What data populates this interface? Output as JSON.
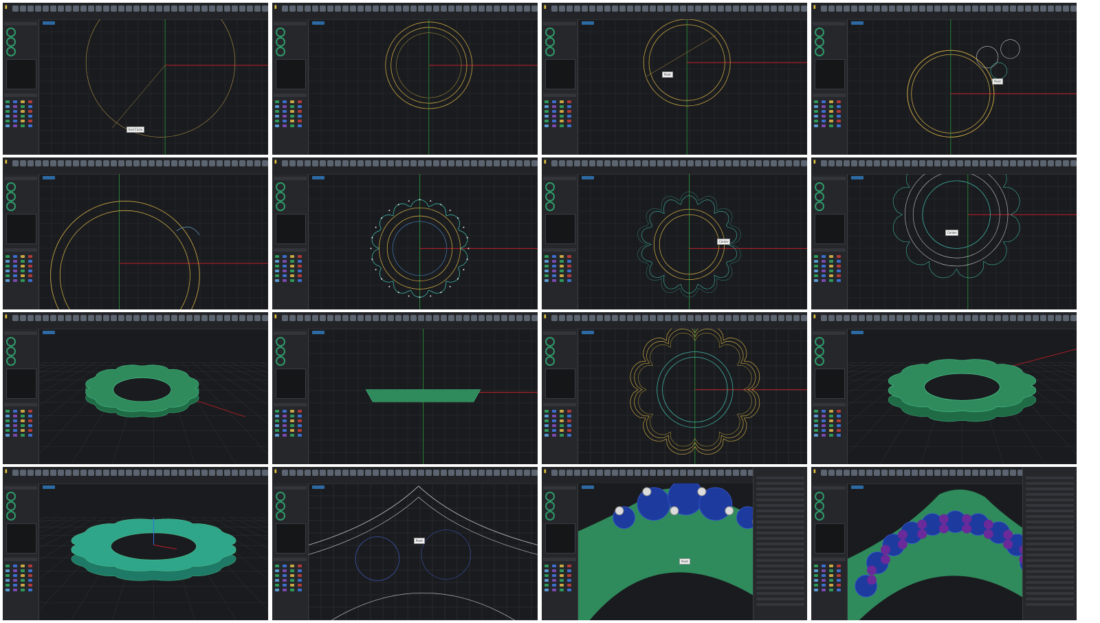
{
  "colors": {
    "background": "#1a1b1e",
    "grid": "#2c2e33",
    "axis_x": "#c0202a",
    "axis_y": "#2a9a3a",
    "curve_yellow": "#c9a845",
    "curve_teal": "#3fb6a8",
    "ring_green": "#2f8a5c",
    "gem_blue": "#1d3a9e",
    "gem_purple": "#6a2a9a",
    "ui_blue": "#2d6aa3"
  },
  "tiles": [
    {
      "name": "step-1-circle-draw",
      "view": "top",
      "callout": "End Circle"
    },
    {
      "name": "step-2-offset-circles",
      "view": "top",
      "callout": ""
    },
    {
      "name": "step-3-tangent-line",
      "view": "top",
      "callout": "Point"
    },
    {
      "name": "step-4-small-circles",
      "view": "top",
      "callout": "Point"
    },
    {
      "name": "step-5-arc-profile",
      "view": "top",
      "callout": ""
    },
    {
      "name": "step-6-petal-array",
      "view": "top",
      "callout": ""
    },
    {
      "name": "step-7-petal-outline",
      "view": "top",
      "callout": "Center"
    },
    {
      "name": "step-8-ring-outline",
      "view": "perspective",
      "callout": "Center"
    },
    {
      "name": "step-9-ring-3d",
      "view": "perspective",
      "callout": ""
    },
    {
      "name": "step-10-ring-side",
      "view": "front",
      "callout": ""
    },
    {
      "name": "step-11-petal-offsets",
      "view": "top",
      "callout": ""
    },
    {
      "name": "step-12-ring-render",
      "view": "perspective",
      "callout": ""
    },
    {
      "name": "step-13-ring-wireframe",
      "view": "perspective",
      "callout": ""
    },
    {
      "name": "step-14-gem-placement",
      "view": "top",
      "callout": "Point"
    },
    {
      "name": "step-15-blue-gems",
      "view": "perspective",
      "callout": "Point"
    },
    {
      "name": "step-16-purple-gems",
      "view": "perspective",
      "callout": ""
    }
  ]
}
